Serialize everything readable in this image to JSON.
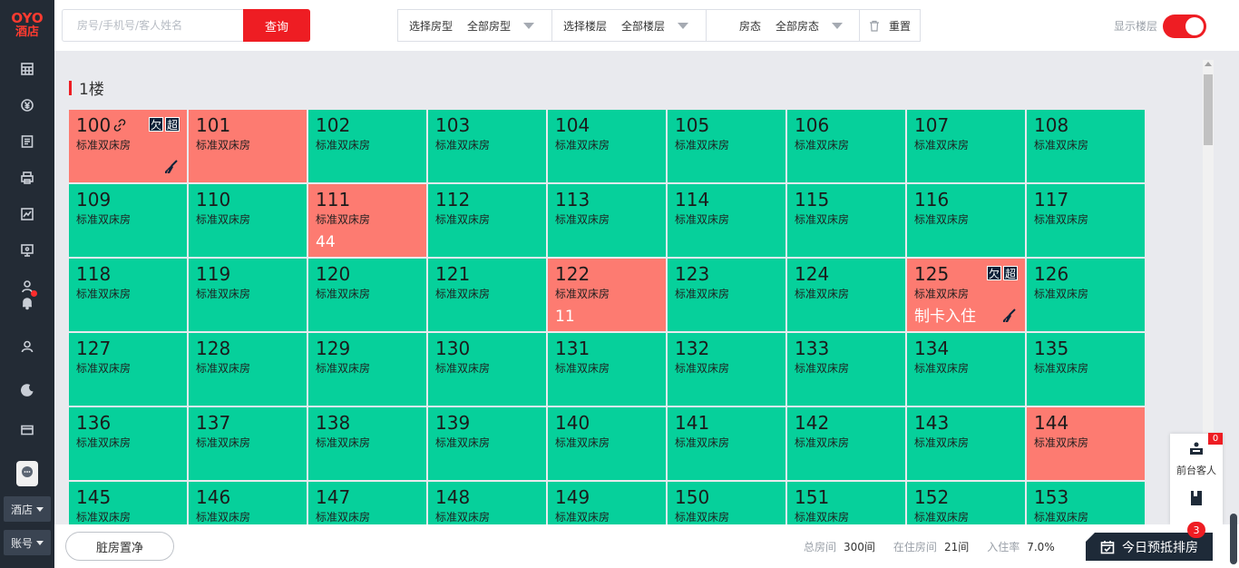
{
  "brand": {
    "logo_top": "OYO",
    "logo_bottom": "酒店",
    "color": "#ee1d23"
  },
  "sidebar": {
    "icons": [
      "calendar-icon",
      "yen-icon",
      "list-icon",
      "printer-icon",
      "chart-icon",
      "monitor-icon",
      "staff-icon",
      "bell-icon",
      "user-icon",
      "night-icon",
      "card-icon",
      "chat-icon"
    ],
    "hotel_label": "酒店",
    "account_label": "账号"
  },
  "topbar": {
    "search_placeholder": "房号/手机号/客人姓名",
    "query_label": "查询",
    "filters": [
      {
        "label": "选择房型",
        "value": "全部房型"
      },
      {
        "label": "选择楼层",
        "value": "全部楼层"
      },
      {
        "label": "房态",
        "value": "全部房态"
      }
    ],
    "reset_label": "重置",
    "show_floor_label": "显示楼层",
    "show_floor_on": true
  },
  "floor": {
    "title": "1楼"
  },
  "rooms": [
    {
      "num": "100",
      "type": "标准双床房",
      "status": "red",
      "link": true,
      "badges": [
        "欠",
        "超"
      ],
      "broom": true
    },
    {
      "num": "101",
      "type": "标准双床房",
      "status": "red"
    },
    {
      "num": "102",
      "type": "标准双床房",
      "status": "green"
    },
    {
      "num": "103",
      "type": "标准双床房",
      "status": "green"
    },
    {
      "num": "104",
      "type": "标准双床房",
      "status": "green"
    },
    {
      "num": "105",
      "type": "标准双床房",
      "status": "green"
    },
    {
      "num": "106",
      "type": "标准双床房",
      "status": "green"
    },
    {
      "num": "107",
      "type": "标准双床房",
      "status": "green"
    },
    {
      "num": "108",
      "type": "标准双床房",
      "status": "green"
    },
    {
      "num": "109",
      "type": "标准双床房",
      "status": "green"
    },
    {
      "num": "110",
      "type": "标准双床房",
      "status": "green"
    },
    {
      "num": "111",
      "type": "标准双床房",
      "status": "red",
      "extra": "44"
    },
    {
      "num": "112",
      "type": "标准双床房",
      "status": "green"
    },
    {
      "num": "113",
      "type": "标准双床房",
      "status": "green"
    },
    {
      "num": "114",
      "type": "标准双床房",
      "status": "green"
    },
    {
      "num": "115",
      "type": "标准双床房",
      "status": "green"
    },
    {
      "num": "116",
      "type": "标准双床房",
      "status": "green"
    },
    {
      "num": "117",
      "type": "标准双床房",
      "status": "green"
    },
    {
      "num": "118",
      "type": "标准双床房",
      "status": "green"
    },
    {
      "num": "119",
      "type": "标准双床房",
      "status": "green"
    },
    {
      "num": "120",
      "type": "标准双床房",
      "status": "green"
    },
    {
      "num": "121",
      "type": "标准双床房",
      "status": "green"
    },
    {
      "num": "122",
      "type": "标准双床房",
      "status": "red",
      "extra": "11"
    },
    {
      "num": "123",
      "type": "标准双床房",
      "status": "green"
    },
    {
      "num": "124",
      "type": "标准双床房",
      "status": "green"
    },
    {
      "num": "125",
      "type": "标准双床房",
      "status": "red",
      "badges": [
        "欠",
        "超"
      ],
      "extra": "制卡入住",
      "broom": true
    },
    {
      "num": "126",
      "type": "标准双床房",
      "status": "green"
    },
    {
      "num": "127",
      "type": "标准双床房",
      "status": "green"
    },
    {
      "num": "128",
      "type": "标准双床房",
      "status": "green"
    },
    {
      "num": "129",
      "type": "标准双床房",
      "status": "green"
    },
    {
      "num": "130",
      "type": "标准双床房",
      "status": "green"
    },
    {
      "num": "131",
      "type": "标准双床房",
      "status": "green"
    },
    {
      "num": "132",
      "type": "标准双床房",
      "status": "green"
    },
    {
      "num": "133",
      "type": "标准双床房",
      "status": "green"
    },
    {
      "num": "134",
      "type": "标准双床房",
      "status": "green"
    },
    {
      "num": "135",
      "type": "标准双床房",
      "status": "green"
    },
    {
      "num": "136",
      "type": "标准双床房",
      "status": "green"
    },
    {
      "num": "137",
      "type": "标准双床房",
      "status": "green"
    },
    {
      "num": "138",
      "type": "标准双床房",
      "status": "green"
    },
    {
      "num": "139",
      "type": "标准双床房",
      "status": "green"
    },
    {
      "num": "140",
      "type": "标准双床房",
      "status": "green"
    },
    {
      "num": "141",
      "type": "标准双床房",
      "status": "green"
    },
    {
      "num": "142",
      "type": "标准双床房",
      "status": "green"
    },
    {
      "num": "143",
      "type": "标准双床房",
      "status": "green"
    },
    {
      "num": "144",
      "type": "标准双床房",
      "status": "red"
    },
    {
      "num": "145",
      "type": "标准双床房",
      "status": "green"
    },
    {
      "num": "146",
      "type": "标准双床房",
      "status": "green"
    },
    {
      "num": "147",
      "type": "标准双床房",
      "status": "green"
    },
    {
      "num": "148",
      "type": "标准双床房",
      "status": "green"
    },
    {
      "num": "149",
      "type": "标准双床房",
      "status": "green"
    },
    {
      "num": "150",
      "type": "标准双床房",
      "status": "green"
    },
    {
      "num": "151",
      "type": "标准双床房",
      "status": "green"
    },
    {
      "num": "152",
      "type": "标准双床房",
      "status": "green"
    },
    {
      "num": "153",
      "type": "标准双床房",
      "status": "green"
    }
  ],
  "colors": {
    "vacant": "#06d09b",
    "occupied": "#fd7b71",
    "badge": "#0e2239"
  },
  "bottombar": {
    "dirty_button": "脏房置净",
    "stats": [
      {
        "label": "总房间",
        "value": "300间"
      },
      {
        "label": "在住房间",
        "value": "21间"
      },
      {
        "label": "入住率",
        "value": "7.0%"
      }
    ],
    "schedule_label": "今日预抵排房",
    "schedule_count": "3"
  },
  "float_panel": {
    "front_desk_label": "前台客人",
    "front_desk_count": "0"
  }
}
